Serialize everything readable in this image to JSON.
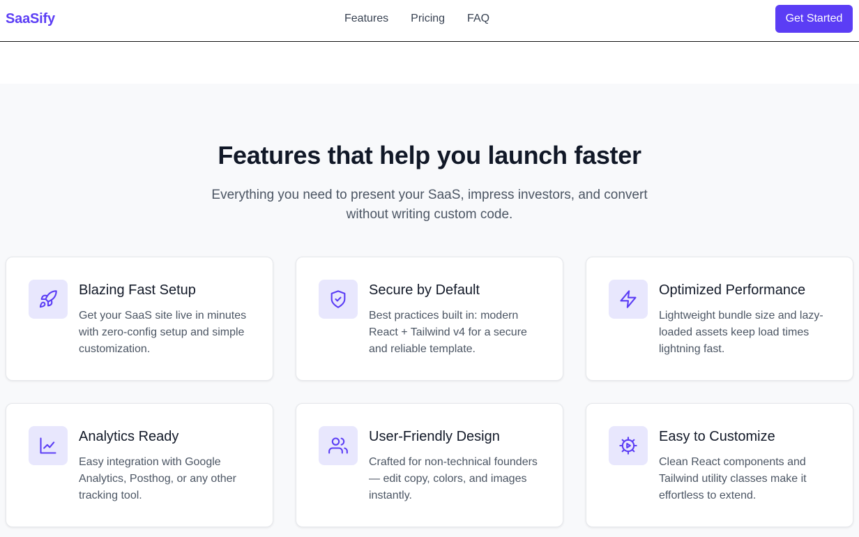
{
  "nav": {
    "logo": "SaaSify",
    "links": [
      "Features",
      "Pricing",
      "FAQ"
    ],
    "cta": "Get Started"
  },
  "features": {
    "title": "Features that help you launch faster",
    "subtitle": "Everything you need to present your SaaS, impress investors, and convert without writing custom code.",
    "items": [
      {
        "icon": "rocket-icon",
        "title": "Blazing Fast Setup",
        "description": "Get your SaaS site live in minutes with zero-config setup and simple customization."
      },
      {
        "icon": "shield-check-icon",
        "title": "Secure by Default",
        "description": "Best practices built in: modern React + Tailwind v4 for a secure and reliable template."
      },
      {
        "icon": "lightning-icon",
        "title": "Optimized Performance",
        "description": "Lightweight bundle size and lazy-loaded assets keep load times lightning fast."
      },
      {
        "icon": "chart-line-icon",
        "title": "Analytics Ready",
        "description": "Easy integration with Google Analytics, Posthog, or any other tracking tool."
      },
      {
        "icon": "users-icon",
        "title": "User-Friendly Design",
        "description": "Crafted for non-technical founders — edit copy, colors, and images instantly."
      },
      {
        "icon": "gear-icon",
        "title": "Easy to Customize",
        "description": "Clean React components and Tailwind utility classes make it effortless to extend."
      }
    ]
  },
  "colors": {
    "brand": "#5b3df5",
    "icon_bg": "#e8e7fd",
    "section_bg": "#f8f9fb"
  }
}
